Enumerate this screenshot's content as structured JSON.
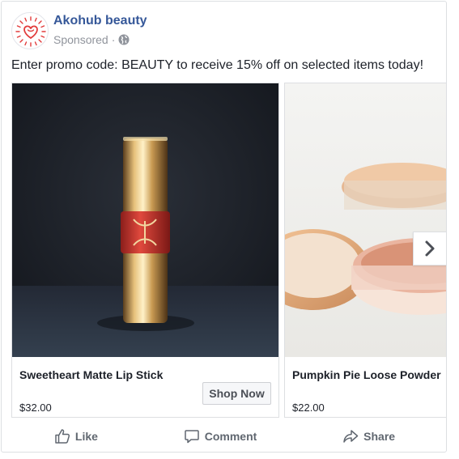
{
  "post": {
    "brand_name": "Akohub beauty",
    "sponsored_label": "Sponsored",
    "separator": "·",
    "text": "Enter promo code: BEAUTY to receive 15% off on selected items today!"
  },
  "carousel": {
    "cards": [
      {
        "title": "Sweetheart Matte Lip Stick",
        "price": "$32.00",
        "cta": "Shop Now"
      },
      {
        "title": "Pumpkin Pie Loose Powder",
        "price": "$22.00"
      }
    ],
    "next_icon": "chevron-right-icon"
  },
  "actions": {
    "like": "Like",
    "comment": "Comment",
    "share": "Share"
  },
  "colors": {
    "brand_link": "#365899",
    "meta_gray": "#90949c",
    "action_gray": "#606770",
    "border": "#dddfe2",
    "logo_red": "#e23b3b"
  }
}
